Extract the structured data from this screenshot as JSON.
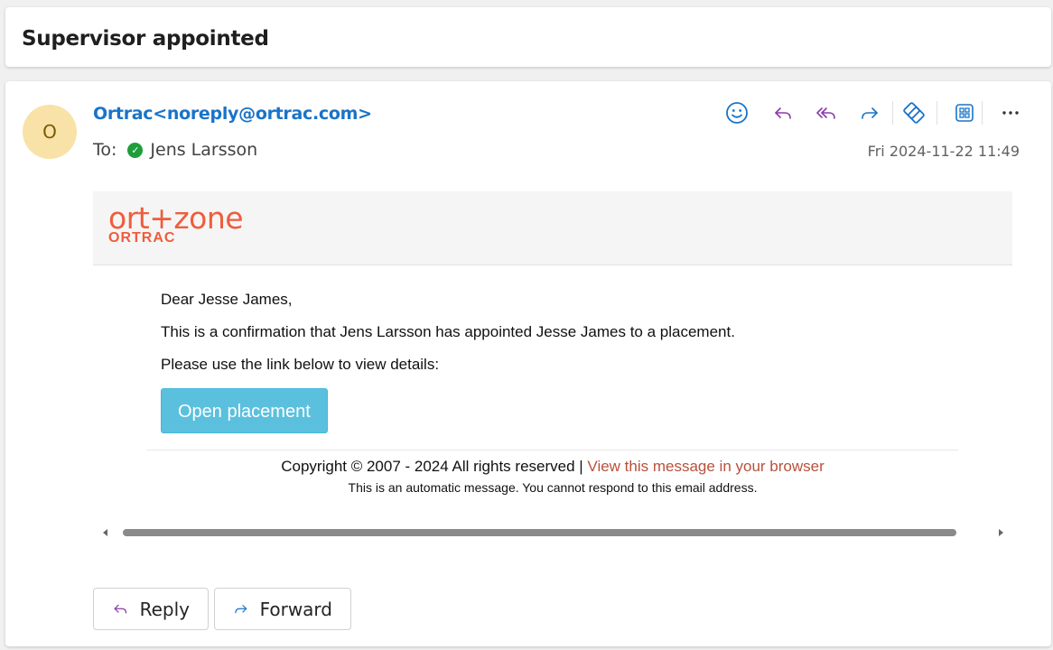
{
  "subject": "Supervisor appointed",
  "message": {
    "avatar_initial": "O",
    "sender": "Ortrac<noreply@ortrac.com>",
    "to_label": "To:",
    "recipient": "Jens Larsson",
    "date": "Fri 2024-11-22 11:49"
  },
  "toolbar": {
    "icons": [
      "emoji-icon",
      "reply-icon",
      "reply-all-icon",
      "forward-icon",
      "addin-icon",
      "apps-icon",
      "more-icon"
    ]
  },
  "email": {
    "logo_top": "ort+zone",
    "logo_bottom": "ORTRAC",
    "greeting": "Dear Jesse James,",
    "line1": "This is a confirmation that Jens Larsson has appointed Jesse James to a placement.",
    "line2": "Please use the link below to view details:",
    "button_label": "Open placement",
    "copyright": "Copyright © 2007 - 2024 All rights reserved | ",
    "browser_link": "View this message in your browser",
    "auto_message": "This is an automatic message. You cannot respond to this email address."
  },
  "footer_actions": {
    "reply": "Reply",
    "forward": "Forward"
  },
  "colors": {
    "accent": "#1a73c9",
    "reply_purple": "#8b3aa8",
    "logo": "#ef5d3c",
    "button": "#5bc0de",
    "link": "#b8513c"
  }
}
